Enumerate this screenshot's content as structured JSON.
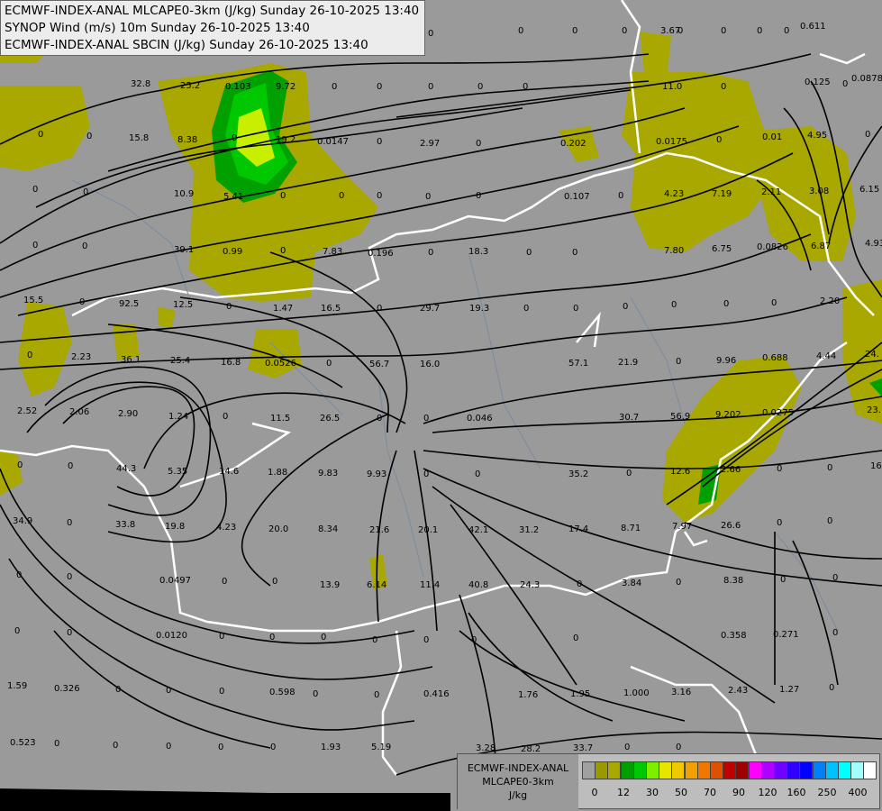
{
  "header": {
    "lines": [
      "ECMWF-INDEX-ANAL MLCAPE0-3km (J/kg) Sunday 26-10-2025 13:40",
      "SYNOP Wind (m/s) 10m Sunday 26-10-2025 13:40",
      "ECMWF-INDEX-ANAL SBCIN (J/kg) Sunday 26-10-2025 13:40"
    ]
  },
  "legend": {
    "title_lines": [
      "ECMWF-INDEX-ANAL",
      "MLCAPE0-3km",
      "J/kg"
    ],
    "colors": [
      "#a0a0a0",
      "#9a9a00",
      "#a8a800",
      "#009f00",
      "#00c800",
      "#7cf000",
      "#e6e600",
      "#f0c800",
      "#f0a000",
      "#f07800",
      "#e05000",
      "#c00000",
      "#a00000",
      "#ff00ff",
      "#b000ff",
      "#7000ff",
      "#3000ff",
      "#0000ff",
      "#0080ff",
      "#00c0ff",
      "#00ffff",
      "#a0ffff",
      "#ffffff"
    ],
    "ticks": [
      "0",
      "12",
      "30",
      "50",
      "70",
      "90",
      "120",
      "160",
      "250",
      "400"
    ]
  },
  "map_labels": [
    "0.611",
    "3.67",
    "0",
    "0",
    "0",
    "0",
    "0",
    "0",
    "0",
    "0",
    "0.125",
    "0.0878",
    "32.8",
    "25.2",
    "0.103",
    "9.72",
    "0",
    "0",
    "0",
    "0",
    "0",
    "11.0",
    "0",
    "0",
    "0",
    "0",
    "15.8",
    "8.38",
    "0",
    "19.2",
    "0.0147",
    "0",
    "2.97",
    "0",
    "0.202",
    "0.0175",
    "0",
    "0.01",
    "4.95",
    "0",
    "0",
    "0",
    "10.9",
    "5.41",
    "0",
    "0",
    "0",
    "0",
    "0",
    "0.107",
    "0",
    "4.23",
    "7.19",
    "2.11",
    "3.08",
    "6.15",
    "0",
    "0",
    "39.1",
    "0.99",
    "0",
    "7.83",
    "0.196",
    "0",
    "18.3",
    "0",
    "0",
    "7.80",
    "6.75",
    "0.0826",
    "6.87",
    "4.93",
    "15.5",
    "0",
    "92.5",
    "12.5",
    "0",
    "1.47",
    "16.5",
    "0",
    "29.7",
    "19.3",
    "0",
    "0",
    "0",
    "0",
    "0",
    "0",
    "2.20",
    "0",
    "2.23",
    "36.1",
    "25.4",
    "16.8",
    "0.0526",
    "0",
    "56.7",
    "16.0",
    "57.1",
    "21.9",
    "0",
    "9.96",
    "0.688",
    "4.44",
    "24.",
    "2.52",
    "2.06",
    "2.90",
    "1.24",
    "0",
    "11.5",
    "26.5",
    "0",
    "0",
    "0.046",
    "30.7",
    "56.9",
    "9.202",
    "0.0275",
    "23.",
    "0",
    "0",
    "44.3",
    "5.35",
    "14.6",
    "1.88",
    "9.83",
    "9.93",
    "0",
    "0",
    "35.2",
    "0",
    "12.6",
    "2.66",
    "0",
    "0",
    "16",
    "34.9",
    "0",
    "33.8",
    "19.8",
    "4.23",
    "20.0",
    "8.34",
    "21.6",
    "20.1",
    "42.1",
    "31.2",
    "17.4",
    "8.71",
    "7.97",
    "26.6",
    "0",
    "0",
    "0",
    "0",
    "0.0497",
    "0",
    "0",
    "13.9",
    "6.14",
    "11.4",
    "40.8",
    "24.3",
    "0",
    "3.84",
    "0",
    "8.38",
    "0",
    "0",
    "0",
    "0",
    "0.0120",
    "0",
    "0",
    "0",
    "0",
    "0",
    "0",
    "0",
    "0.358",
    "0.271",
    "0",
    "1.59",
    "0.326",
    "0",
    "0",
    "0",
    "0.598",
    "0",
    "0",
    "0.416",
    "1.76",
    "1.95",
    "1.000",
    "3.16",
    "2.43",
    "1.27",
    "0",
    "0.523",
    "0",
    "0",
    "0",
    "0",
    "0",
    "1.93",
    "5.19",
    "3.28",
    "28.2",
    "33.7",
    "0",
    "0"
  ],
  "map_colors": {
    "background": "#9a9a9a",
    "cape_low": "#a8a800",
    "cape_green": "#00b400",
    "cape_yellow": "#e6f000",
    "border": "#ffffff",
    "streamline": "#000000"
  }
}
